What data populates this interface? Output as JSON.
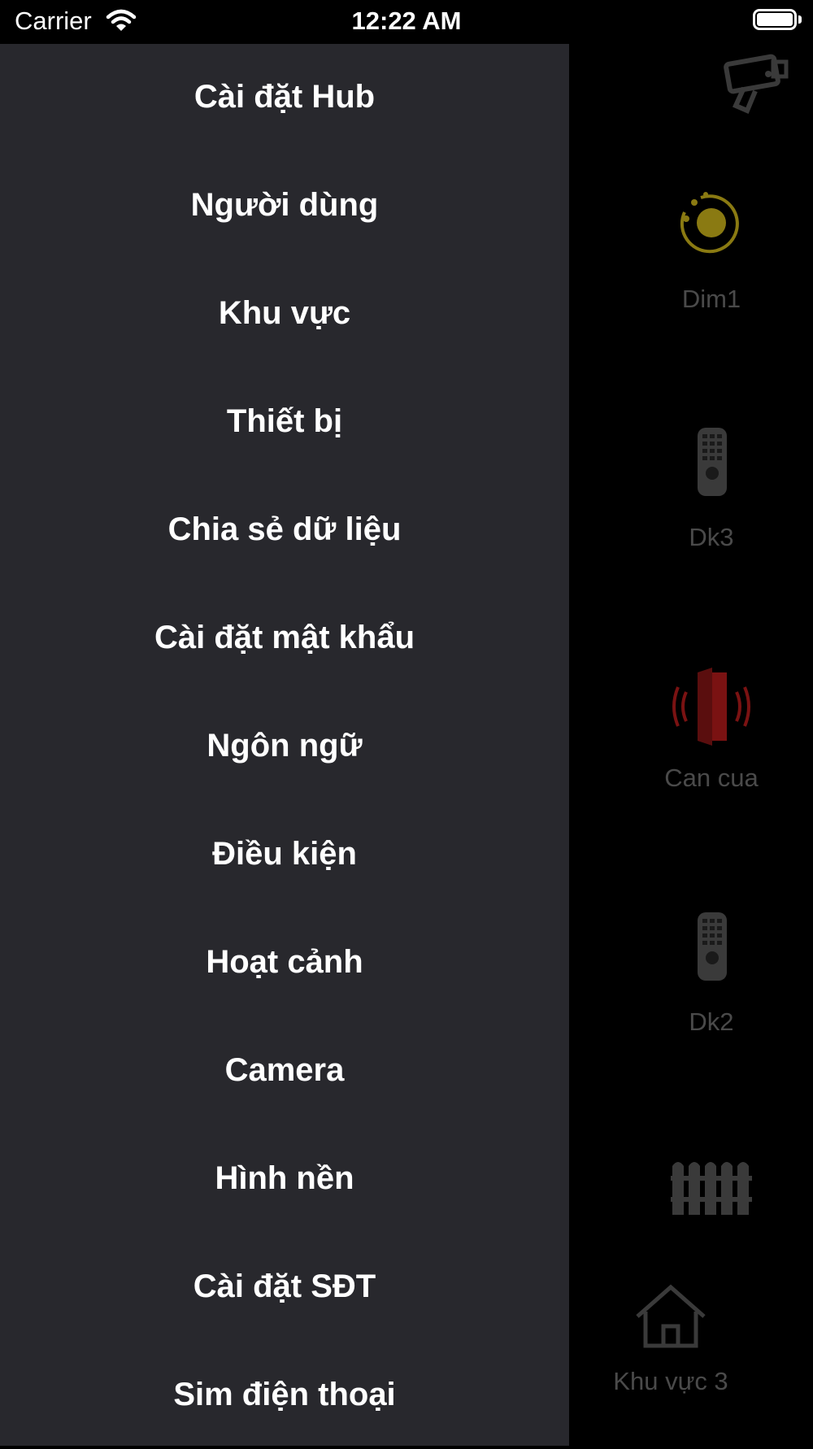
{
  "status_bar": {
    "carrier": "Carrier",
    "time": "12:22 AM",
    "wifi_icon": "wifi-icon",
    "battery_icon": "battery-icon"
  },
  "background": {
    "camera_icon": "security-camera-icon",
    "devices": [
      {
        "label": "Dim1",
        "icon": "dimmer-light-icon"
      },
      {
        "label": "Dk3",
        "icon": "remote-control-icon"
      },
      {
        "label": "Can cua",
        "icon": "door-alert-icon"
      },
      {
        "label": "Dk2",
        "icon": "remote-control-icon"
      },
      {
        "label": "",
        "icon": "fence-icon"
      }
    ],
    "partial_label": "o",
    "area_tab": {
      "label": "Khu vực 3",
      "icon": "home-icon"
    },
    "colors": {
      "dimmer": "#8a7a12",
      "door": "#7a1212"
    }
  },
  "drawer": {
    "items": [
      {
        "label": "Cài đặt Hub"
      },
      {
        "label": "Người dùng"
      },
      {
        "label": "Khu vực"
      },
      {
        "label": "Thiết bị"
      },
      {
        "label": "Chia sẻ dữ liệu"
      },
      {
        "label": "Cài đặt mật khẩu"
      },
      {
        "label": "Ngôn ngữ"
      },
      {
        "label": "Điều kiện"
      },
      {
        "label": "Hoạt cảnh"
      },
      {
        "label": "Camera"
      },
      {
        "label": "Hình nền"
      },
      {
        "label": "Cài đặt SĐT"
      },
      {
        "label": "Sim điện thoại"
      }
    ]
  }
}
